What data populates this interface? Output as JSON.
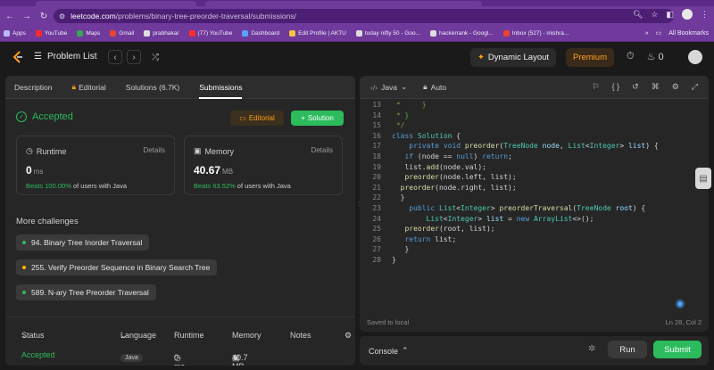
{
  "browser": {
    "url_host": "leetcode.com",
    "url_path": "/problems/binary-tree-preorder-traversal/submissions/",
    "bookmarks": [
      {
        "label": "Apps",
        "color": "#b9b9ff"
      },
      {
        "label": "YouTube",
        "color": "#ff2b2b"
      },
      {
        "label": "Maps",
        "color": "#34a853"
      },
      {
        "label": "Gmail",
        "color": "#ea4335"
      },
      {
        "label": "prabhakar",
        "color": "#dddddd"
      },
      {
        "label": "(77) YouTube",
        "color": "#ff2b2b"
      },
      {
        "label": "Dashboard",
        "color": "#5aa0ff"
      },
      {
        "label": "Edit Profile | AKTU",
        "color": "#f5c542"
      },
      {
        "label": "today nifty 50 - Goo...",
        "color": "#dddddd"
      },
      {
        "label": "hackerrank - Googl...",
        "color": "#dddddd"
      },
      {
        "label": "Inbox (527) - mishra...",
        "color": "#ea4335"
      }
    ],
    "all_bookmarks": "All Bookmarks"
  },
  "header": {
    "problem_list": "Problem List",
    "dynamic_layout": "Dynamic Layout",
    "premium": "Premium",
    "streak": "0"
  },
  "left": {
    "tabs": [
      {
        "label": "Description"
      },
      {
        "label": "Editorial"
      },
      {
        "label": "Solutions (6.7K)"
      },
      {
        "label": "Submissions"
      }
    ],
    "status": "Accepted",
    "editorial_btn": "Editorial",
    "solution_btn": "Solution",
    "runtime": {
      "label": "Runtime",
      "details": "Details",
      "value": "0",
      "unit": "ms",
      "beats_pct": "Beats 100.00%",
      "beats_rest": "of users with Java"
    },
    "memory": {
      "label": "Memory",
      "details": "Details",
      "value": "40.67",
      "unit": "MB",
      "beats_pct": "Beats 63.52%",
      "beats_rest": "of users with Java"
    },
    "more_title": "More challenges",
    "challenges": [
      {
        "label": "94. Binary Tree Inorder Traversal",
        "color": "#2cbb5d"
      },
      {
        "label": "255. Verify Preorder Sequence in Binary Search Tree",
        "color": "#ffb800"
      },
      {
        "label": "589. N-ary Tree Preorder Traversal",
        "color": "#2cbb5d"
      }
    ],
    "table_head": {
      "status": "Status",
      "language": "Language",
      "runtime": "Runtime",
      "memory": "Memory",
      "notes": "Notes"
    },
    "row": {
      "status": "Accepted",
      "language": "Java",
      "runtime": "0 ms",
      "memory": "40.7 MB"
    }
  },
  "editor": {
    "language": "Java",
    "mode": "Auto",
    "footer_left": "Saved to local",
    "footer_right": "Ln 28, Col 2",
    "lines": [
      {
        "n": "13",
        "html": "<span class=\"cm\"> *     }</span>"
      },
      {
        "n": "14",
        "html": "<span class=\"cm\"> * }</span>"
      },
      {
        "n": "15",
        "html": "<span class=\"cm\"> */</span>"
      },
      {
        "n": "16",
        "html": "<span class=\"kw\">class</span> <span class=\"ty\">Solution</span> {"
      },
      {
        "n": "17",
        "html": "    <span class=\"kw\">private</span> <span class=\"kw\">void</span> <span class=\"fn\">preorder</span>(<span class=\"ty\">TreeNode</span> <span class=\"id\">node</span>, <span class=\"ty\">List</span>&lt;<span class=\"ty\">Integer</span>&gt; <span class=\"id\">list</span>) {"
      },
      {
        "n": "18",
        "html": "   <span class=\"kw\">if</span> (node == <span class=\"kw\">null</span>) <span class=\"kw\">return</span>;"
      },
      {
        "n": "19",
        "html": "   list.<span class=\"fn\">add</span>(node.val);"
      },
      {
        "n": "20",
        "html": "   <span class=\"fn\">preorder</span>(node.left, list);"
      },
      {
        "n": "21",
        "html": "  <span class=\"fn\">preorder</span>(node.right, list);"
      },
      {
        "n": "22",
        "html": "  }"
      },
      {
        "n": "23",
        "html": "    <span class=\"kw\">public</span> <span class=\"ty\">List</span>&lt;<span class=\"ty\">Integer</span>&gt; <span class=\"fn\">preorderTraversal</span>(<span class=\"ty\">TreeNode</span> <span class=\"id\">root</span>) {"
      },
      {
        "n": "24",
        "html": "        <span class=\"ty\">List</span>&lt;<span class=\"ty\">Integer</span>&gt; <span class=\"id\">list</span> = <span class=\"kw\">new</span> <span class=\"ty\">ArrayList</span>&lt;&gt;();"
      },
      {
        "n": "25",
        "html": "   <span class=\"fn\">preorder</span>(root, list);"
      },
      {
        "n": "26",
        "html": "   <span class=\"kw\">return</span> list;"
      },
      {
        "n": "27",
        "html": "   }"
      },
      {
        "n": "28",
        "html": "}"
      }
    ]
  },
  "console": {
    "label": "Console",
    "run": "Run",
    "submit": "Submit"
  }
}
